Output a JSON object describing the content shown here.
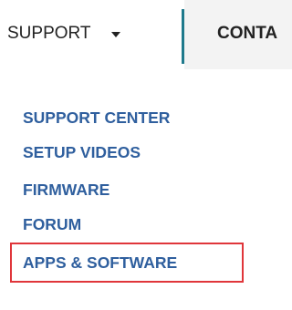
{
  "nav": {
    "support_label": "SUPPORT",
    "contact_label": "CONTA"
  },
  "menu": {
    "items": [
      {
        "label": "SUPPORT CENTER"
      },
      {
        "label": "SETUP VIDEOS"
      },
      {
        "label": "FIRMWARE"
      },
      {
        "label": "FORUM"
      },
      {
        "label": "APPS & SOFTWARE",
        "highlighted": true
      }
    ]
  },
  "colors": {
    "menu_link": "#2f5f9e",
    "highlight_border": "#e0363b",
    "divider": "#1f7a8c"
  }
}
